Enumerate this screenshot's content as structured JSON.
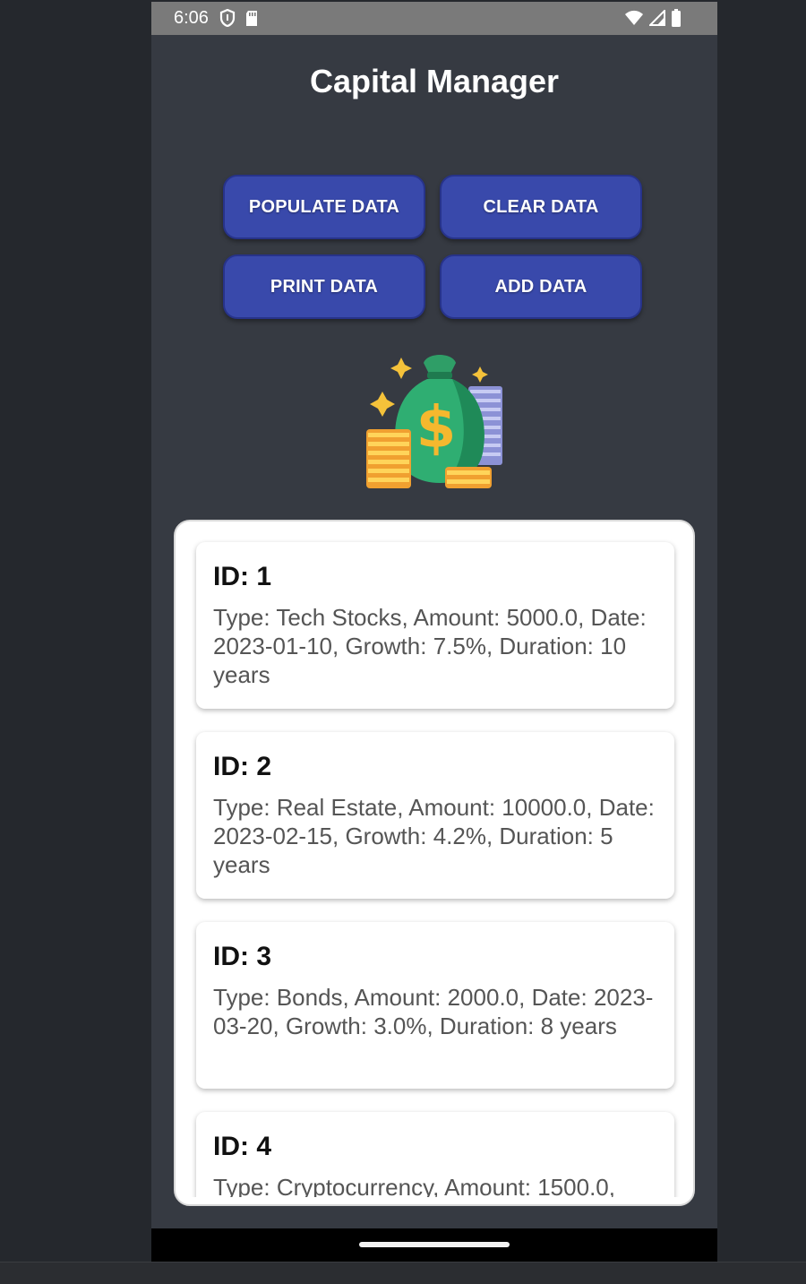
{
  "status_bar": {
    "time": "6:06",
    "left_icons": [
      "shield-icon",
      "sd-card-icon"
    ],
    "right_icons": [
      "wifi-icon",
      "signal-icon",
      "battery-icon"
    ]
  },
  "app": {
    "title": "Capital Manager"
  },
  "buttons": {
    "populate": "POPULATE DATA",
    "clear": "CLEAR DATA",
    "print": "PRINT DATA",
    "add": "ADD DATA"
  },
  "hero": {
    "icon": "money-bag-icon",
    "symbol": "$"
  },
  "records": [
    {
      "id": "ID: 1",
      "text": "Type: Tech Stocks, Amount: 5000.0, Date: 2023-01-10, Growth: 7.5%, Duration: 10 years"
    },
    {
      "id": "ID: 2",
      "text": "Type: Real Estate, Amount: 10000.0, Date: 2023-02-15, Growth: 4.2%, Duration: 5 years"
    },
    {
      "id": "ID: 3",
      "text": "Type: Bonds, Amount: 2000.0, Date: 2023-03-20, Growth: 3.0%, Duration: 8 years"
    },
    {
      "id": "ID: 4",
      "text": "Type: Cryptocurrency, Amount: 1500.0,"
    }
  ],
  "colors": {
    "background": "#363a42",
    "button": "#3949ab",
    "status_bar": "#7a7a7a",
    "card": "#ffffff"
  }
}
